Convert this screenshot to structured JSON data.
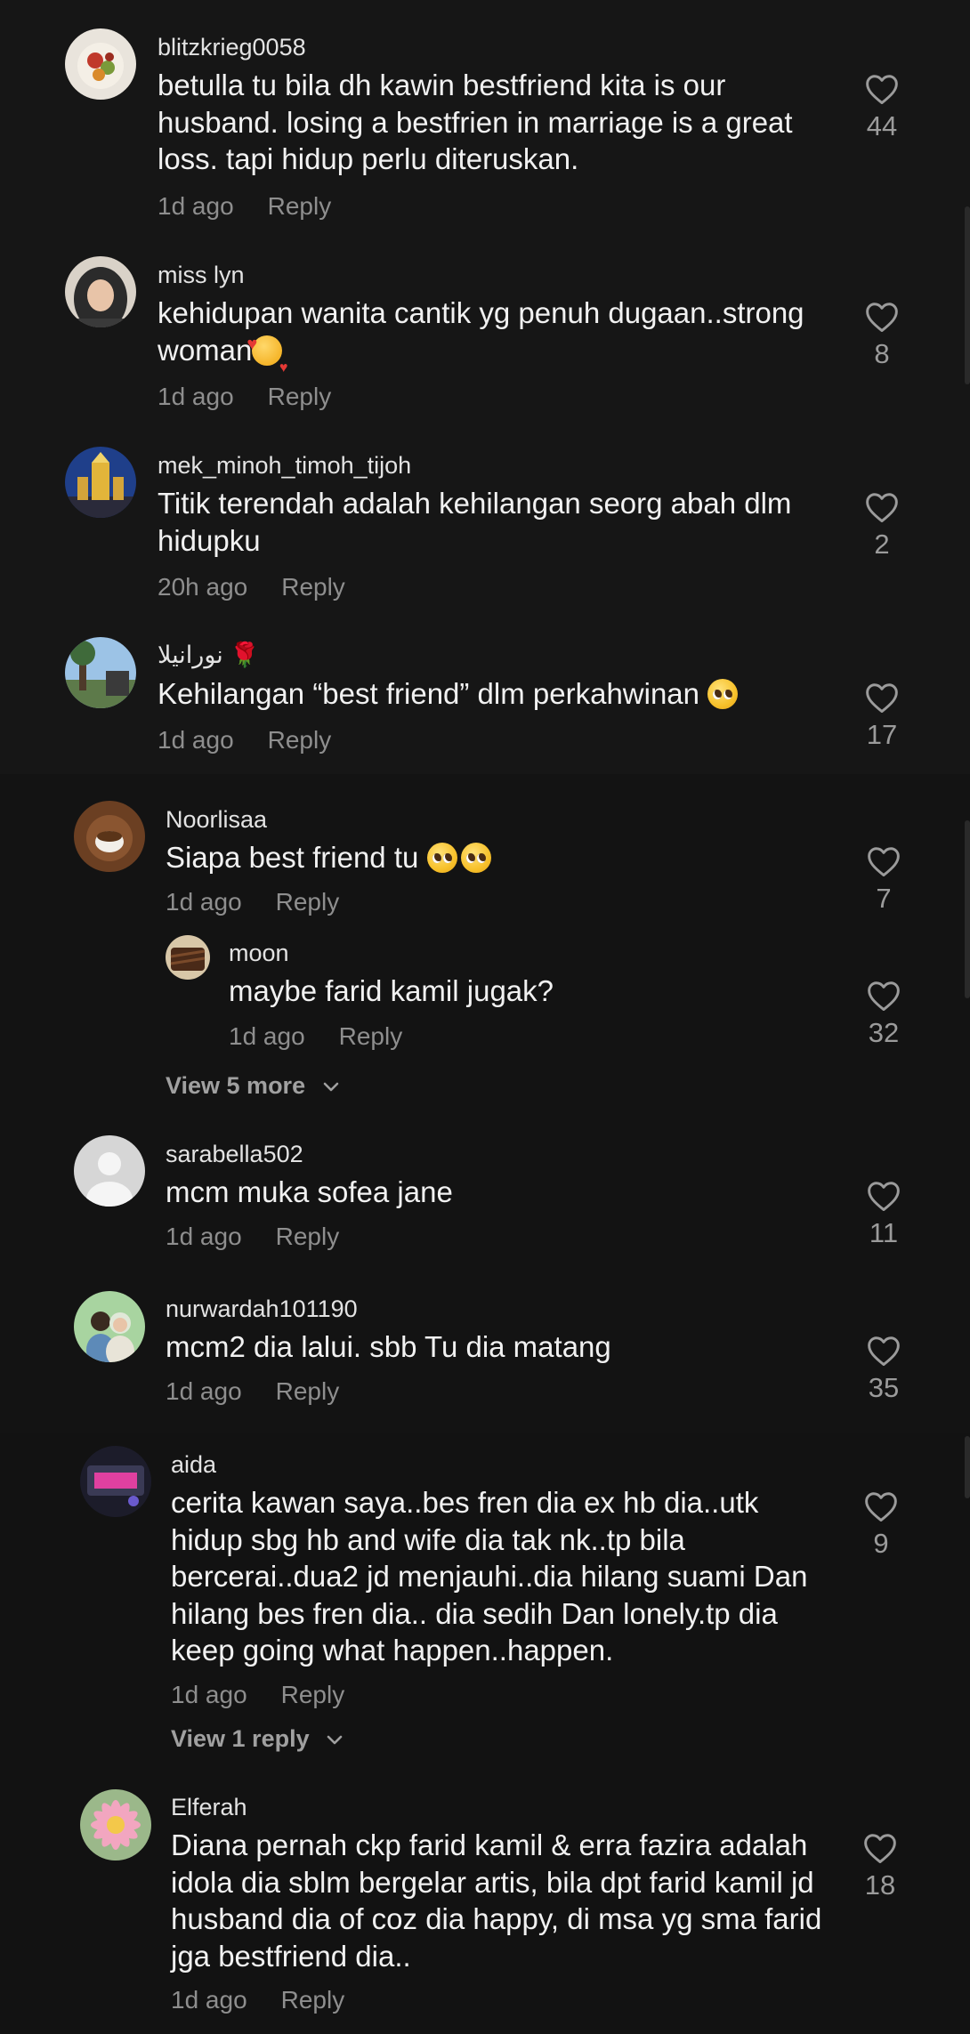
{
  "comments": [
    {
      "username": "blitzkrieg0058",
      "text": "betulla tu bila dh kawin bestfriend kita is our husband. losing a bestfrien in marriage is a great loss. tapi hidup perlu diteruskan.",
      "time": "1d ago",
      "reply": "Reply",
      "likes": "44",
      "avatar": "food-avatar"
    },
    {
      "username": "miss lyn",
      "text": "kehidupan wanita cantik yg penuh dugaan..strong woman",
      "time": "1d ago",
      "reply": "Reply",
      "likes": "8",
      "avatar": "hijab-avatar"
    },
    {
      "username": "mek_minoh_timoh_tijoh",
      "text": "Titik terendah adalah kehilangan seorg abah dlm hidupku",
      "time": "20h ago",
      "reply": "Reply",
      "likes": "2",
      "avatar": "building-avatar"
    },
    {
      "username": "نورانيلا",
      "text": "Kehilangan “best friend” dlm perkahwinan",
      "time": "1d ago",
      "reply": "Reply",
      "likes": "17",
      "avatar": "outdoor-avatar"
    },
    {
      "username": "Noorlisaa",
      "text": "Siapa best friend tu",
      "time": "1d ago",
      "reply": "Reply",
      "likes": "7",
      "avatar": "coffee-avatar"
    },
    {
      "username": "moon",
      "text": "maybe farid kamil jugak?",
      "time": "1d ago",
      "reply": "Reply",
      "likes": "32",
      "avatar": "chocolate-avatar"
    },
    {
      "username": "sarabella502",
      "text": "mcm muka sofea jane",
      "time": "1d ago",
      "reply": "Reply",
      "likes": "11",
      "avatar": "default-avatar"
    },
    {
      "username": "nurwardah101190",
      "text": "mcm2 dia lalui. sbb Tu dia matang",
      "time": "1d ago",
      "reply": "Reply",
      "likes": "35",
      "avatar": "couple-avatar"
    },
    {
      "username": "aida",
      "text": "cerita kawan saya..bes fren dia ex hb dia..utk hidup sbg hb and wife dia tak nk..tp bila bercerai..dua2 jd menjauhi..dia hilang suami Dan hilang bes fren dia.. dia sedih Dan lonely.tp dia keep going what happen..happen.",
      "time": "1d ago",
      "reply": "Reply",
      "likes": "9",
      "avatar": "photo-avatar"
    },
    {
      "username": "Elferah",
      "text": "Diana pernah ckp farid kamil & erra fazira adalah idola dia sblm bergelar artis, bila dpt farid kamil jd husband dia of coz dia happy, di msa yg sma farid jga bestfriend dia..",
      "time": "1d ago",
      "reply": "Reply",
      "likes": "18",
      "avatar": "flower-avatar"
    }
  ],
  "view_more": [
    {
      "label": "View 5 more"
    },
    {
      "label": "View 1 reply"
    }
  ],
  "colors": {
    "background": "#161616",
    "text": "#f1f1f1",
    "muted": "#8e8e8e"
  },
  "icons": {
    "like": "heart-outline-icon",
    "expand": "chevron-down-icon"
  }
}
